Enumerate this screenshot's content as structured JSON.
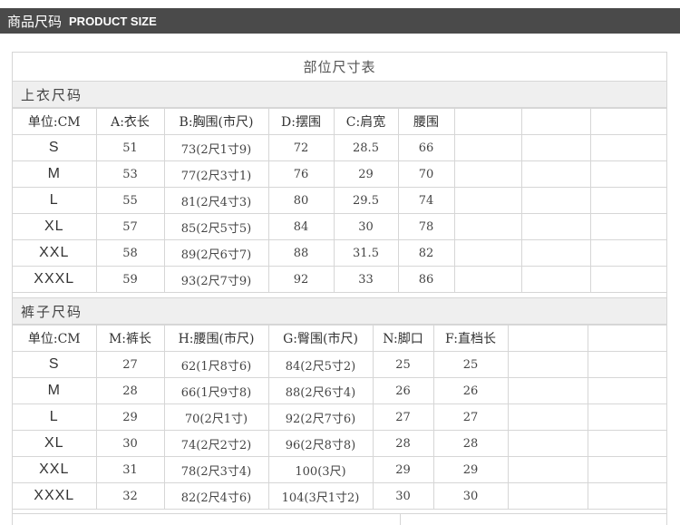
{
  "header": {
    "title_cn": "商品尺码",
    "title_en": "PRODUCT SIZE"
  },
  "table_title": "部位尺寸表",
  "top": {
    "section_label": "上衣尺码",
    "columns": [
      "单位:CM",
      "A:衣长",
      "B:胸围(市尺)",
      "D:摆围",
      "C:肩宽",
      "腰围",
      "",
      "",
      ""
    ],
    "rows": [
      [
        "S",
        "51",
        "73(2尺1寸9)",
        "72",
        "28.5",
        "66",
        "",
        "",
        ""
      ],
      [
        "M",
        "53",
        "77(2尺3寸1)",
        "76",
        "29",
        "70",
        "",
        "",
        ""
      ],
      [
        "L",
        "55",
        "81(2尺4寸3)",
        "80",
        "29.5",
        "74",
        "",
        "",
        ""
      ],
      [
        "XL",
        "57",
        "85(2尺5寸5)",
        "84",
        "30",
        "78",
        "",
        "",
        ""
      ],
      [
        "XXL",
        "58",
        "89(2尺6寸7)",
        "88",
        "31.5",
        "82",
        "",
        "",
        ""
      ],
      [
        "XXXL",
        "59",
        "93(2尺7寸9)",
        "92",
        "33",
        "86",
        "",
        "",
        ""
      ]
    ]
  },
  "bottom": {
    "section_label": "裤子尺码",
    "columns": [
      "单位:CM",
      "M:裤长",
      "H:腰围(市尺)",
      "G:臀围(市尺)",
      "N:脚口",
      "F:直档长",
      "",
      ""
    ],
    "rows": [
      [
        "S",
        "27",
        "62(1尺8寸6)",
        "84(2尺5寸2)",
        "25",
        "25",
        "",
        ""
      ],
      [
        "M",
        "28",
        "66(1尺9寸8)",
        "88(2尺6寸4)",
        "26",
        "26",
        "",
        ""
      ],
      [
        "L",
        "29",
        "70(2尺1寸)",
        "92(2尺7寸6)",
        "27",
        "27",
        "",
        ""
      ],
      [
        "XL",
        "30",
        "74(2尺2寸2)",
        "96(2尺8寸8)",
        "28",
        "28",
        "",
        ""
      ],
      [
        "XXL",
        "31",
        "78(2尺3寸4)",
        "100(3尺)",
        "29",
        "29",
        "",
        ""
      ],
      [
        "XXXL",
        "32",
        "82(2尺4寸6)",
        "104(3尺1寸2)",
        "30",
        "30",
        "",
        ""
      ]
    ]
  }
}
